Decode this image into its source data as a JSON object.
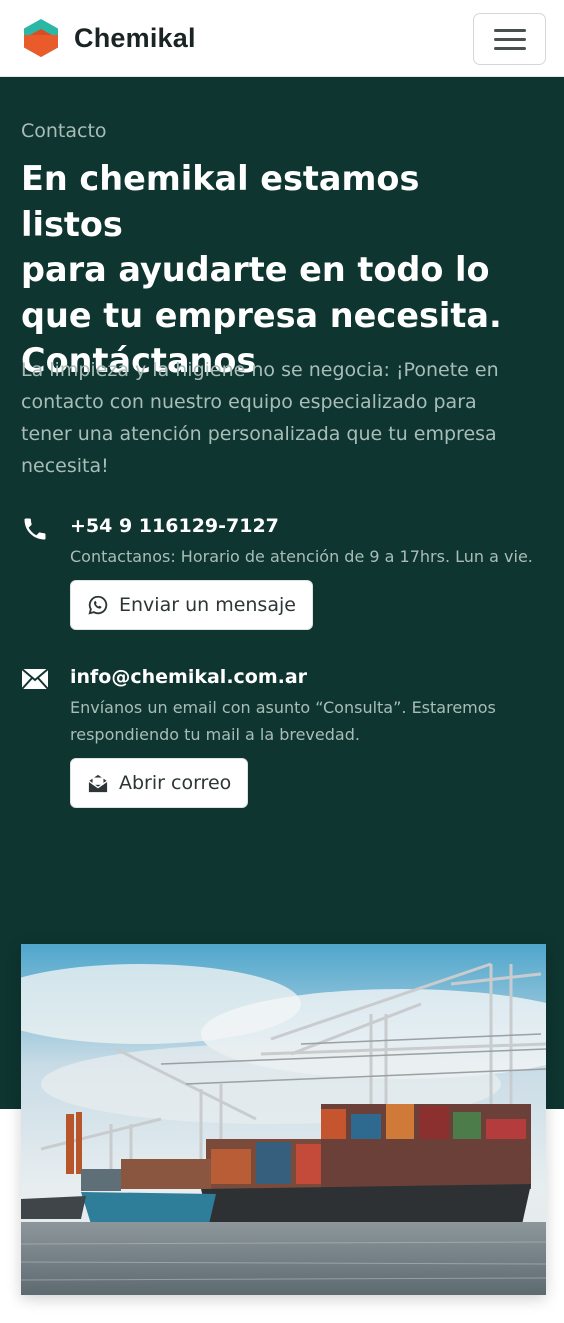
{
  "navbar": {
    "brand_name": "Chemikal",
    "logo_icon": "hexagon-logo-icon",
    "menu_icon": "hamburger-menu-icon"
  },
  "hero": {
    "kicker": "Contacto",
    "headline_lines": [
      "En chemikal estamos listos",
      "para ayudarte en todo lo",
      "que tu empresa necesita.",
      "Contáctanos"
    ],
    "lead_lines": [
      "La limpieza y la higiene no se negocia: ¡Ponete en",
      "contacto con nuestro equipo especializado para",
      "tener una atención personalizada que tu empresa",
      "necesita!"
    ]
  },
  "contacts": {
    "phone": {
      "icon": "phone-icon",
      "title": "+54 9 116129-7127",
      "description": "Contactanos: Horario de atención de 9 a 17hrs. Lun a vie.",
      "button_label": "Enviar un mensaje",
      "button_icon": "whatsapp-icon"
    },
    "email": {
      "icon": "envelope-icon",
      "title": "info@chemikal.com.ar",
      "description_lines": [
        "Envíanos un email con asunto “Consulta”. Estaremos",
        "respondiendo tu mail a la brevedad."
      ],
      "button_label": "Abrir correo",
      "button_icon": "open-envelope-icon"
    }
  },
  "colors": {
    "hero_background": "#0e3530",
    "muted_text": "#a9bdb8",
    "logo_teal": "#2bb7a6",
    "logo_orange": "#ea5b2c"
  }
}
